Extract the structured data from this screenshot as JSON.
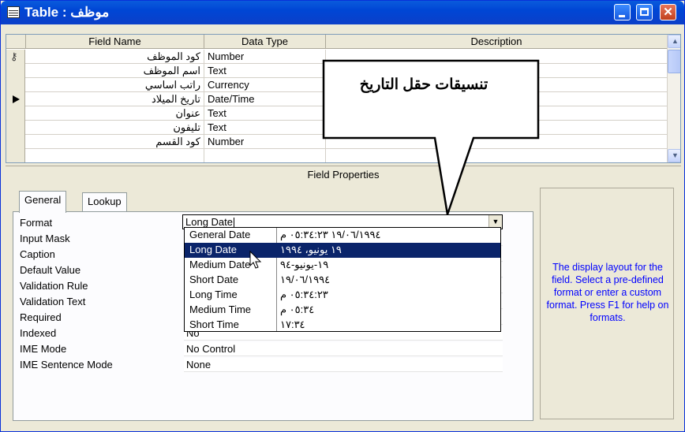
{
  "window": {
    "title": "موظف : Table"
  },
  "grid": {
    "headers": [
      "Field Name",
      "Data Type",
      "Description"
    ],
    "rows": [
      {
        "name": "كود الموظف",
        "type": "Number",
        "description": "",
        "key": true
      },
      {
        "name": "اسم الموظف",
        "type": "Text",
        "description": ""
      },
      {
        "name": "راتب اساسي",
        "type": "Currency",
        "description": ""
      },
      {
        "name": "تاريخ الميلاد",
        "type": "Date/Time",
        "description": "",
        "current": true
      },
      {
        "name": "عنوان",
        "type": "Text",
        "description": ""
      },
      {
        "name": "تليفون",
        "type": "Text",
        "description": ""
      },
      {
        "name": "كود القسم",
        "type": "Number",
        "description": ""
      },
      {
        "name": "",
        "type": "",
        "description": ""
      }
    ]
  },
  "field_properties": {
    "title": "Field Properties",
    "tabs": [
      "General",
      "Lookup"
    ],
    "format": {
      "label": "Format",
      "value": "Long Date"
    },
    "properties": [
      {
        "label": "Input Mask",
        "value": ""
      },
      {
        "label": "Caption",
        "value": ""
      },
      {
        "label": "Default Value",
        "value": ""
      },
      {
        "label": "Validation Rule",
        "value": ""
      },
      {
        "label": "Validation Text",
        "value": ""
      },
      {
        "label": "Required",
        "value": ""
      },
      {
        "label": "Indexed",
        "value": "No"
      },
      {
        "label": "IME Mode",
        "value": "No Control"
      },
      {
        "label": "IME Sentence Mode",
        "value": "None"
      }
    ]
  },
  "format_dropdown": {
    "options": [
      {
        "name": "General Date",
        "sample": "١٩/٠٦/١٩٩٤ ٠٥:٣٤:٢٣ م"
      },
      {
        "name": "Long Date",
        "sample": "١٩ يونيو، ١٩٩٤",
        "selected": true
      },
      {
        "name": "Medium Date",
        "sample": "١٩-يونيو-٩٤"
      },
      {
        "name": "Short Date",
        "sample": "١٩/٠٦/١٩٩٤"
      },
      {
        "name": "Long Time",
        "sample": "٠٥:٣٤:٢٣ م"
      },
      {
        "name": "Medium Time",
        "sample": "٠٥:٣٤ م"
      },
      {
        "name": "Short Time",
        "sample": "١٧:٣٤"
      }
    ]
  },
  "help": {
    "text": "The display layout for the field.  Select a pre-defined format or enter a custom format.  Press F1 for help on formats."
  },
  "callout": {
    "text": "تنسيقات حقل التاريخ"
  },
  "colors": {
    "titlebar": "#0a5bdc",
    "selection": "#0a246a",
    "help_text": "#0000ff"
  }
}
